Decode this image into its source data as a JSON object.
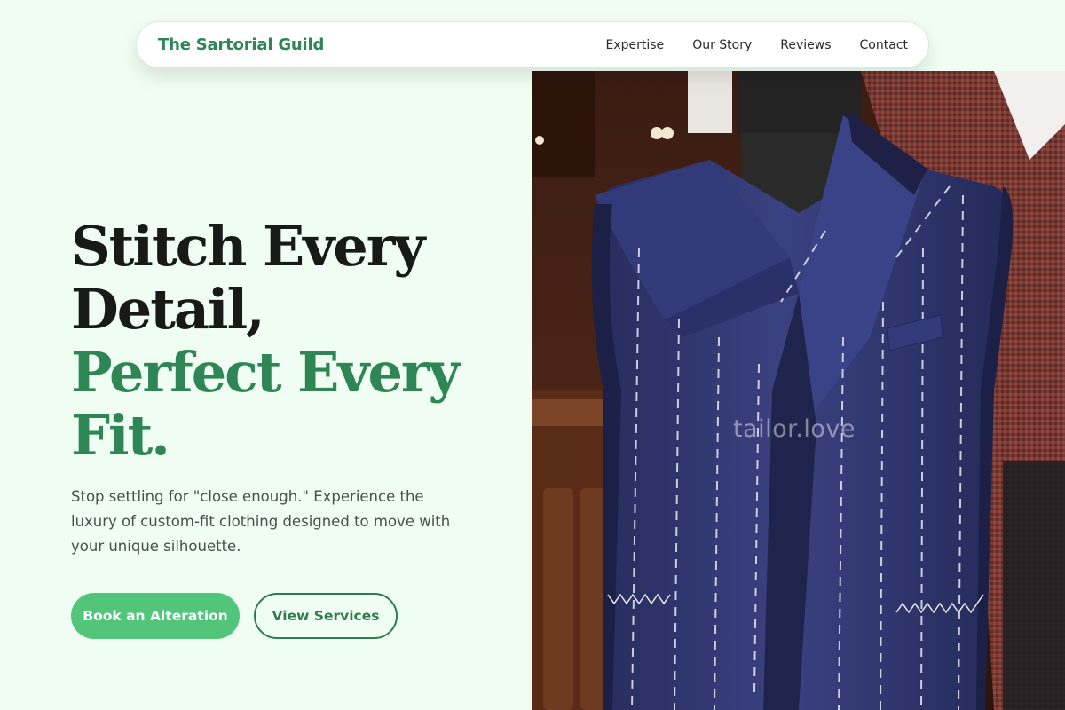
{
  "brand": {
    "name": "The Sartorial Guild"
  },
  "nav": {
    "links": [
      {
        "label": "Expertise"
      },
      {
        "label": "Our Story"
      },
      {
        "label": "Reviews"
      },
      {
        "label": "Contact"
      }
    ]
  },
  "hero": {
    "headline_line1": "Stitch Every",
    "headline_line2": "Detail,",
    "headline_accent_line1": "Perfect Every",
    "headline_accent_line2": "Fit.",
    "subtext": "Stop settling for \"close enough.\" Experience the luxury of custom-fit clothing designed to move with your unique silhouette.",
    "primary_cta": "Book an Alteration",
    "secondary_cta": "View Services",
    "image_watermark": "tailor.love"
  },
  "colors": {
    "background": "#effdf3",
    "accent": "#2e8655",
    "button_primary": "#52c57a",
    "suit_navy": "#2f3670"
  }
}
